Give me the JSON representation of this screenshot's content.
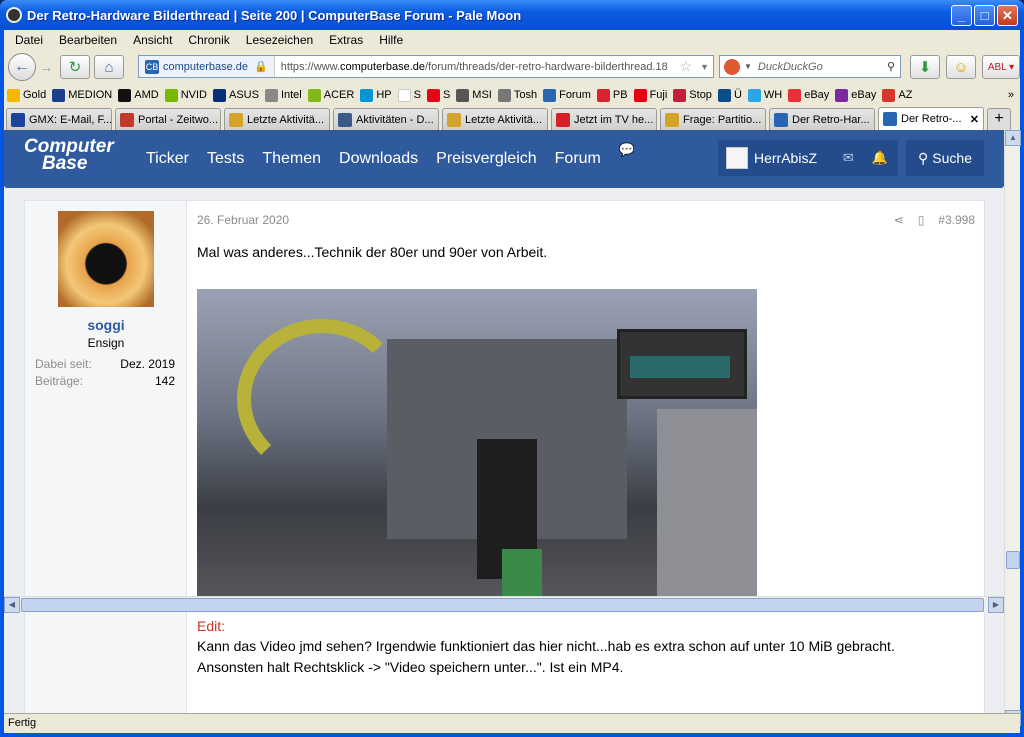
{
  "window": {
    "title": "Der Retro-Hardware Bilderthread | Seite 200 | ComputerBase Forum - Pale Moon"
  },
  "menu": [
    "Datei",
    "Bearbeiten",
    "Ansicht",
    "Chronik",
    "Lesezeichen",
    "Extras",
    "Hilfe"
  ],
  "navbar": {
    "site_label": "computerbase.de",
    "url_prefix": "https://www.",
    "url_domain": "computerbase.de",
    "url_rest": "/forum/threads/der-retro-hardware-bilderthread.18",
    "search_placeholder": "DuckDuckGo"
  },
  "bookmarks": [
    {
      "label": "Gold",
      "color": "#f5b800"
    },
    {
      "label": "MEDION",
      "color": "#1b3f8b"
    },
    {
      "label": "AMD",
      "color": "#111111"
    },
    {
      "label": "NVID",
      "color": "#76b900"
    },
    {
      "label": "ASUS",
      "color": "#0a2f7a"
    },
    {
      "label": "Intel",
      "color": "#888888"
    },
    {
      "label": "ACER",
      "color": "#83b81a"
    },
    {
      "label": "HP",
      "color": "#0096d6"
    },
    {
      "label": "S",
      "color": "#ffffff"
    },
    {
      "label": "S",
      "color": "#e30613"
    },
    {
      "label": "MSI",
      "color": "#555555"
    },
    {
      "label": "Tosh",
      "color": "#777777"
    },
    {
      "label": "Forum",
      "color": "#2966b1"
    },
    {
      "label": "PB",
      "color": "#d9232e"
    },
    {
      "label": "Fuji",
      "color": "#e60012"
    },
    {
      "label": "Stop",
      "color": "#c41e3a"
    },
    {
      "label": "Ü",
      "color": "#0b4d8a"
    },
    {
      "label": "WH",
      "color": "#2aa7e0"
    },
    {
      "label": "eBay",
      "color": "#e53238"
    },
    {
      "label": "eBay",
      "color": "#7b2a9d"
    },
    {
      "label": "AZ",
      "color": "#d33a2c"
    }
  ],
  "tabs": [
    {
      "label": "GMX: E-Mail, F...",
      "color": "#1c449b"
    },
    {
      "label": "Portal - Zeitwo...",
      "color": "#c0392b"
    },
    {
      "label": "Letzte Aktivitä...",
      "color": "#d4a32a"
    },
    {
      "label": "Aktivitäten - D...",
      "color": "#3a5a8a"
    },
    {
      "label": "Letzte Aktivitä...",
      "color": "#d4a32a"
    },
    {
      "label": "Jetzt im TV he...",
      "color": "#d61f26"
    },
    {
      "label": "Frage: Partitio...",
      "color": "#d4a32a"
    },
    {
      "label": "Der Retro-Har...",
      "color": "#2966b1"
    },
    {
      "label": "Der Retro-...",
      "color": "#2966b1",
      "active": true
    }
  ],
  "site": {
    "logo_line1": "Computer",
    "logo_line2": "Base",
    "nav": [
      "Ticker",
      "Tests",
      "Themen",
      "Downloads",
      "Preisvergleich",
      "Forum"
    ],
    "username": "HerrAbisZ",
    "search_label": "Suche"
  },
  "post": {
    "author": "soggi",
    "rank": "Ensign",
    "joined_label": "Dabei seit:",
    "joined_value": "Dez. 2019",
    "posts_label": "Beiträge:",
    "posts_value": "142",
    "date": "26. Februar 2020",
    "number": "#3.998",
    "text": "Mal was anderes...Technik der 80er und 90er von Arbeit.",
    "edit_label": "Edit:",
    "line1": "Kann das Video jmd sehen? Irgendwie funktioniert das hier nicht...hab es extra schon auf unter 10 MiB gebracht.",
    "line2": "Ansonsten halt Rechtsklick -> \"Video speichern unter...\". Ist ein MP4."
  },
  "status": "Fertig"
}
